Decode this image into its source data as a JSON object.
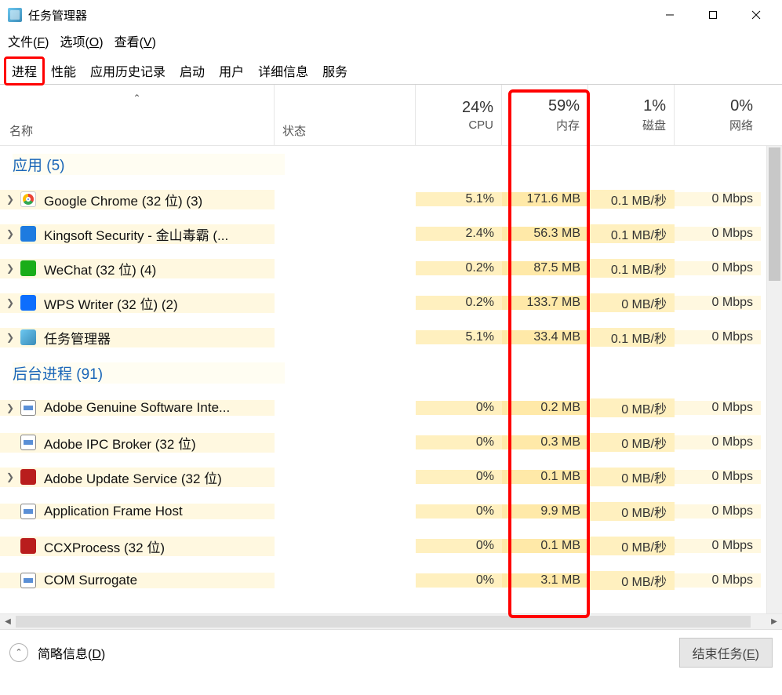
{
  "window": {
    "title": "任务管理器"
  },
  "menubar": [
    {
      "label": "文件",
      "accel": "F"
    },
    {
      "label": "选项",
      "accel": "O"
    },
    {
      "label": "查看",
      "accel": "V"
    }
  ],
  "tabs": [
    {
      "label": "进程",
      "active": true,
      "highlighted": true
    },
    {
      "label": "性能"
    },
    {
      "label": "应用历史记录"
    },
    {
      "label": "启动"
    },
    {
      "label": "用户"
    },
    {
      "label": "详细信息"
    },
    {
      "label": "服务"
    }
  ],
  "columns": {
    "name_label": "名称",
    "status_label": "状态",
    "cpu": {
      "pct": "24%",
      "label": "CPU"
    },
    "memory": {
      "pct": "59%",
      "label": "内存",
      "highlighted": true
    },
    "disk": {
      "pct": "1%",
      "label": "磁盘"
    },
    "network": {
      "pct": "0%",
      "label": "网络"
    }
  },
  "groups": [
    {
      "title": "应用 (5)",
      "rows": [
        {
          "icon": "chrome",
          "expandable": true,
          "name": "Google Chrome (32 位) (3)",
          "cpu": "5.1%",
          "mem": "171.6 MB",
          "disk": "0.1 MB/秒",
          "net": "0 Mbps"
        },
        {
          "icon": "king",
          "expandable": true,
          "name": "Kingsoft Security - 金山毒霸 (...",
          "cpu": "2.4%",
          "mem": "56.3 MB",
          "disk": "0.1 MB/秒",
          "net": "0 Mbps"
        },
        {
          "icon": "wechat",
          "expandable": true,
          "name": "WeChat (32 位) (4)",
          "cpu": "0.2%",
          "mem": "87.5 MB",
          "disk": "0.1 MB/秒",
          "net": "0 Mbps"
        },
        {
          "icon": "wps",
          "expandable": true,
          "name": "WPS Writer (32 位) (2)",
          "cpu": "0.2%",
          "mem": "133.7 MB",
          "disk": "0 MB/秒",
          "net": "0 Mbps"
        },
        {
          "icon": "tm",
          "expandable": true,
          "name": "任务管理器",
          "cpu": "5.1%",
          "mem": "33.4 MB",
          "disk": "0.1 MB/秒",
          "net": "0 Mbps"
        }
      ]
    },
    {
      "title": "后台进程 (91)",
      "rows": [
        {
          "icon": "generic",
          "expandable": true,
          "name": "Adobe Genuine Software Inte...",
          "cpu": "0%",
          "mem": "0.2 MB",
          "disk": "0 MB/秒",
          "net": "0 Mbps"
        },
        {
          "icon": "generic",
          "expandable": false,
          "name": "Adobe IPC Broker (32 位)",
          "cpu": "0%",
          "mem": "0.3 MB",
          "disk": "0 MB/秒",
          "net": "0 Mbps"
        },
        {
          "icon": "adobe",
          "expandable": true,
          "name": "Adobe Update Service (32 位)",
          "cpu": "0%",
          "mem": "0.1 MB",
          "disk": "0 MB/秒",
          "net": "0 Mbps"
        },
        {
          "icon": "generic",
          "expandable": false,
          "name": "Application Frame Host",
          "cpu": "0%",
          "mem": "9.9 MB",
          "disk": "0 MB/秒",
          "net": "0 Mbps"
        },
        {
          "icon": "adobe",
          "expandable": false,
          "name": "CCXProcess (32 位)",
          "cpu": "0%",
          "mem": "0.1 MB",
          "disk": "0 MB/秒",
          "net": "0 Mbps"
        },
        {
          "icon": "generic",
          "expandable": false,
          "name": "COM Surrogate",
          "cpu": "0%",
          "mem": "3.1 MB",
          "disk": "0 MB/秒",
          "net": "0 Mbps"
        }
      ]
    }
  ],
  "footer": {
    "brief_label": "简略信息",
    "brief_accel": "D",
    "end_task_label": "结束任务",
    "end_task_accel": "E"
  }
}
